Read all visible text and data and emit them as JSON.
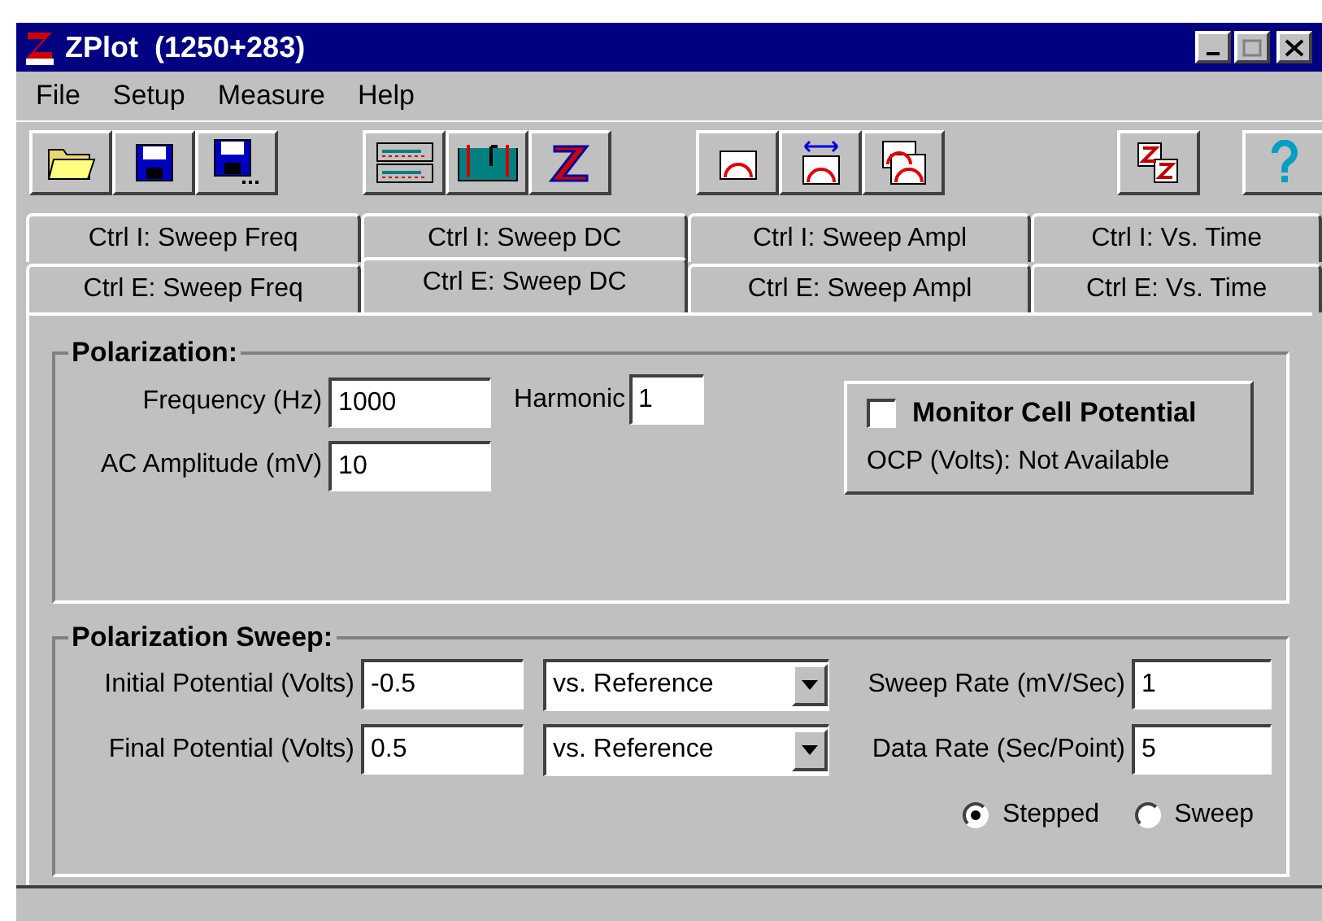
{
  "window": {
    "title": "ZPlot  (1250+283)"
  },
  "menu": [
    "File",
    "Setup",
    "Measure",
    "Help"
  ],
  "tab_rows": [
    [
      {
        "label": "Ctrl I: Sweep Freq",
        "selected": false
      },
      {
        "label": "Ctrl I: Sweep DC",
        "selected": false
      },
      {
        "label": "Ctrl I: Sweep Ampl",
        "selected": false
      },
      {
        "label": "Ctrl I: Vs. Time",
        "selected": false
      }
    ],
    [
      {
        "label": "Ctrl E: Sweep Freq",
        "selected": false
      },
      {
        "label": "Ctrl E: Sweep DC",
        "selected": true
      },
      {
        "label": "Ctrl E: Sweep Ampl",
        "selected": false
      },
      {
        "label": "Ctrl E: Vs. Time",
        "selected": false
      }
    ]
  ],
  "polarization": {
    "title": "Polarization:",
    "frequency": {
      "label": "Frequency (Hz)",
      "value": "1000"
    },
    "harmonic": {
      "label": "Harmonic",
      "value": "1"
    },
    "amplitude": {
      "label": "AC Amplitude (mV)",
      "value": "10"
    },
    "monitor": {
      "label": "Monitor Cell Potential",
      "checked": false,
      "ocp": "OCP (Volts): Not Available"
    }
  },
  "sweep": {
    "title": "Polarization Sweep:",
    "rows": [
      {
        "label": "Initial Potential (Volts)",
        "value": "-0.5",
        "reference": "vs. Reference",
        "rate_label": "Sweep Rate (mV/Sec)",
        "rate_value": "1"
      },
      {
        "label": "Final Potential (Volts)",
        "value": "0.5",
        "reference": "vs. Reference",
        "rate_label": "Data Rate (Sec/Point)",
        "rate_value": "5"
      }
    ],
    "modes": [
      {
        "label": "Stepped",
        "selected": true
      },
      {
        "label": "Sweep",
        "selected": false
      }
    ]
  }
}
